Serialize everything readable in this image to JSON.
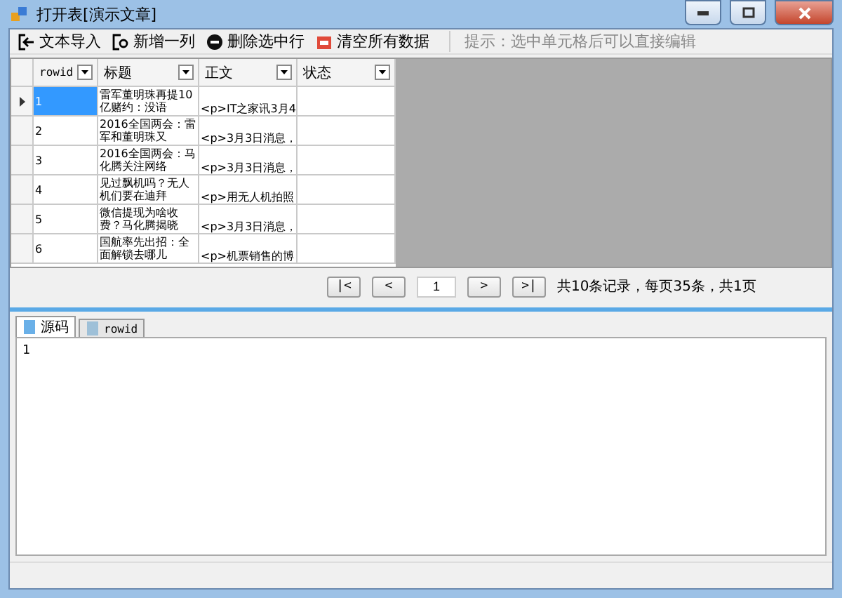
{
  "window": {
    "title": "打开表[演示文章]"
  },
  "toolbar": {
    "buttons": [
      {
        "kind": "import",
        "label": "文本导入"
      },
      {
        "kind": "add",
        "label": "新增一列"
      },
      {
        "kind": "delete",
        "label": "删除选中行"
      },
      {
        "kind": "clear",
        "label": "清空所有数据"
      }
    ],
    "hint": "提示：选中单元格后可以直接编辑"
  },
  "table": {
    "columns": [
      "rowid",
      "标题",
      "正文",
      "状态"
    ],
    "rows": [
      {
        "rowid": "1",
        "title": "雷军董明珠再提10亿赌约：没语",
        "body": "<p>IT之家讯3月4",
        "status": "",
        "selected": true
      },
      {
        "rowid": "2",
        "title": "2016全国两会：雷军和董明珠又",
        "body": "<p>3月3日消息，",
        "status": "",
        "selected": false
      },
      {
        "rowid": "3",
        "title": "2016全国两会：马化腾关注网络",
        "body": "<p>3月3日消息，",
        "status": "",
        "selected": false
      },
      {
        "rowid": "4",
        "title": "见过飘机吗？无人机们要在迪拜",
        "body": "<p>用无人机拍照",
        "status": "",
        "selected": false
      },
      {
        "rowid": "5",
        "title": "微信提现为啥收费？马化腾揭晓",
        "body": "<p>3月3日消息，",
        "status": "",
        "selected": false
      },
      {
        "rowid": "6",
        "title": "国航率先出招：全面解锁去哪儿",
        "body": "<p>机票销售的博",
        "status": "",
        "selected": false
      }
    ]
  },
  "pager": {
    "first": "|<",
    "prev": "<",
    "page": "1",
    "next": ">",
    "last": ">|",
    "summary": "共10条记录，每页35条，共1页"
  },
  "tabs": [
    {
      "label": "源码",
      "selected": true
    },
    {
      "label": "rowid",
      "selected": false
    }
  ],
  "editor": {
    "value": "1"
  }
}
